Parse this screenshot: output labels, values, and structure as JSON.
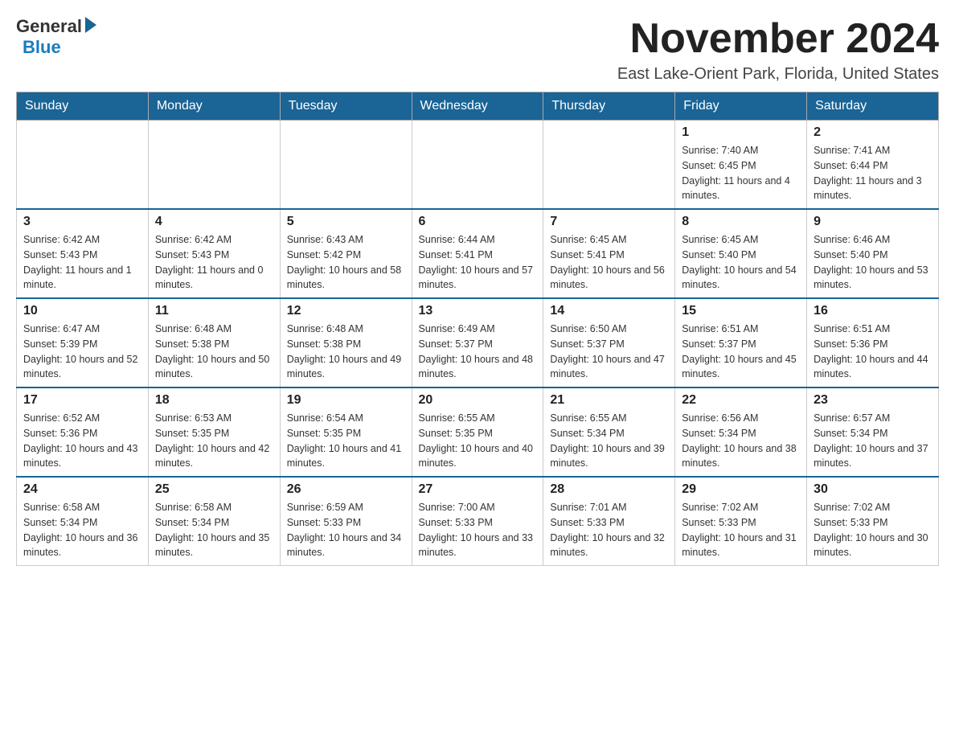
{
  "header": {
    "logo_general": "General",
    "logo_blue": "Blue",
    "month_title": "November 2024",
    "location": "East Lake-Orient Park, Florida, United States"
  },
  "weekdays": [
    "Sunday",
    "Monday",
    "Tuesday",
    "Wednesday",
    "Thursday",
    "Friday",
    "Saturday"
  ],
  "weeks": [
    [
      {
        "day": "",
        "info": ""
      },
      {
        "day": "",
        "info": ""
      },
      {
        "day": "",
        "info": ""
      },
      {
        "day": "",
        "info": ""
      },
      {
        "day": "",
        "info": ""
      },
      {
        "day": "1",
        "info": "Sunrise: 7:40 AM\nSunset: 6:45 PM\nDaylight: 11 hours and 4 minutes."
      },
      {
        "day": "2",
        "info": "Sunrise: 7:41 AM\nSunset: 6:44 PM\nDaylight: 11 hours and 3 minutes."
      }
    ],
    [
      {
        "day": "3",
        "info": "Sunrise: 6:42 AM\nSunset: 5:43 PM\nDaylight: 11 hours and 1 minute."
      },
      {
        "day": "4",
        "info": "Sunrise: 6:42 AM\nSunset: 5:43 PM\nDaylight: 11 hours and 0 minutes."
      },
      {
        "day": "5",
        "info": "Sunrise: 6:43 AM\nSunset: 5:42 PM\nDaylight: 10 hours and 58 minutes."
      },
      {
        "day": "6",
        "info": "Sunrise: 6:44 AM\nSunset: 5:41 PM\nDaylight: 10 hours and 57 minutes."
      },
      {
        "day": "7",
        "info": "Sunrise: 6:45 AM\nSunset: 5:41 PM\nDaylight: 10 hours and 56 minutes."
      },
      {
        "day": "8",
        "info": "Sunrise: 6:45 AM\nSunset: 5:40 PM\nDaylight: 10 hours and 54 minutes."
      },
      {
        "day": "9",
        "info": "Sunrise: 6:46 AM\nSunset: 5:40 PM\nDaylight: 10 hours and 53 minutes."
      }
    ],
    [
      {
        "day": "10",
        "info": "Sunrise: 6:47 AM\nSunset: 5:39 PM\nDaylight: 10 hours and 52 minutes."
      },
      {
        "day": "11",
        "info": "Sunrise: 6:48 AM\nSunset: 5:38 PM\nDaylight: 10 hours and 50 minutes."
      },
      {
        "day": "12",
        "info": "Sunrise: 6:48 AM\nSunset: 5:38 PM\nDaylight: 10 hours and 49 minutes."
      },
      {
        "day": "13",
        "info": "Sunrise: 6:49 AM\nSunset: 5:37 PM\nDaylight: 10 hours and 48 minutes."
      },
      {
        "day": "14",
        "info": "Sunrise: 6:50 AM\nSunset: 5:37 PM\nDaylight: 10 hours and 47 minutes."
      },
      {
        "day": "15",
        "info": "Sunrise: 6:51 AM\nSunset: 5:37 PM\nDaylight: 10 hours and 45 minutes."
      },
      {
        "day": "16",
        "info": "Sunrise: 6:51 AM\nSunset: 5:36 PM\nDaylight: 10 hours and 44 minutes."
      }
    ],
    [
      {
        "day": "17",
        "info": "Sunrise: 6:52 AM\nSunset: 5:36 PM\nDaylight: 10 hours and 43 minutes."
      },
      {
        "day": "18",
        "info": "Sunrise: 6:53 AM\nSunset: 5:35 PM\nDaylight: 10 hours and 42 minutes."
      },
      {
        "day": "19",
        "info": "Sunrise: 6:54 AM\nSunset: 5:35 PM\nDaylight: 10 hours and 41 minutes."
      },
      {
        "day": "20",
        "info": "Sunrise: 6:55 AM\nSunset: 5:35 PM\nDaylight: 10 hours and 40 minutes."
      },
      {
        "day": "21",
        "info": "Sunrise: 6:55 AM\nSunset: 5:34 PM\nDaylight: 10 hours and 39 minutes."
      },
      {
        "day": "22",
        "info": "Sunrise: 6:56 AM\nSunset: 5:34 PM\nDaylight: 10 hours and 38 minutes."
      },
      {
        "day": "23",
        "info": "Sunrise: 6:57 AM\nSunset: 5:34 PM\nDaylight: 10 hours and 37 minutes."
      }
    ],
    [
      {
        "day": "24",
        "info": "Sunrise: 6:58 AM\nSunset: 5:34 PM\nDaylight: 10 hours and 36 minutes."
      },
      {
        "day": "25",
        "info": "Sunrise: 6:58 AM\nSunset: 5:34 PM\nDaylight: 10 hours and 35 minutes."
      },
      {
        "day": "26",
        "info": "Sunrise: 6:59 AM\nSunset: 5:33 PM\nDaylight: 10 hours and 34 minutes."
      },
      {
        "day": "27",
        "info": "Sunrise: 7:00 AM\nSunset: 5:33 PM\nDaylight: 10 hours and 33 minutes."
      },
      {
        "day": "28",
        "info": "Sunrise: 7:01 AM\nSunset: 5:33 PM\nDaylight: 10 hours and 32 minutes."
      },
      {
        "day": "29",
        "info": "Sunrise: 7:02 AM\nSunset: 5:33 PM\nDaylight: 10 hours and 31 minutes."
      },
      {
        "day": "30",
        "info": "Sunrise: 7:02 AM\nSunset: 5:33 PM\nDaylight: 10 hours and 30 minutes."
      }
    ]
  ]
}
